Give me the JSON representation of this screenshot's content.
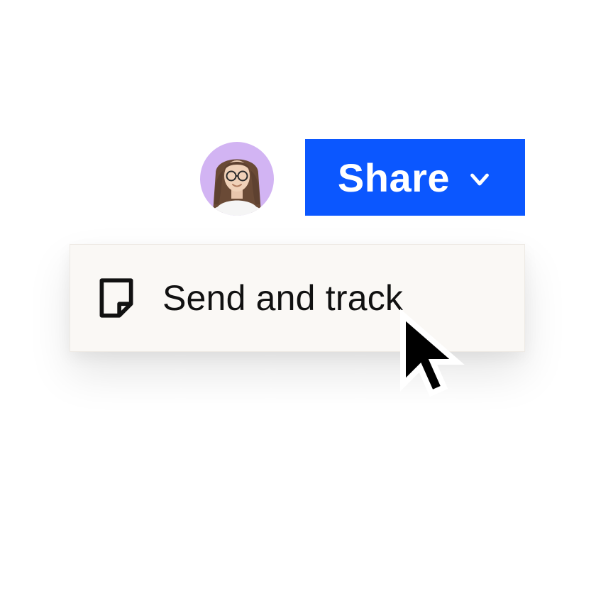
{
  "header": {
    "share_label": "Share",
    "avatar_bg": "#d2b4f3",
    "button_bg": "#0b57ff"
  },
  "menu": {
    "item_label": "Send and track",
    "panel_bg": "#faf8f5"
  },
  "icons": {
    "chevron": "chevron-down-icon",
    "note": "note-fold-icon",
    "cursor": "cursor-icon",
    "avatar": "avatar"
  }
}
